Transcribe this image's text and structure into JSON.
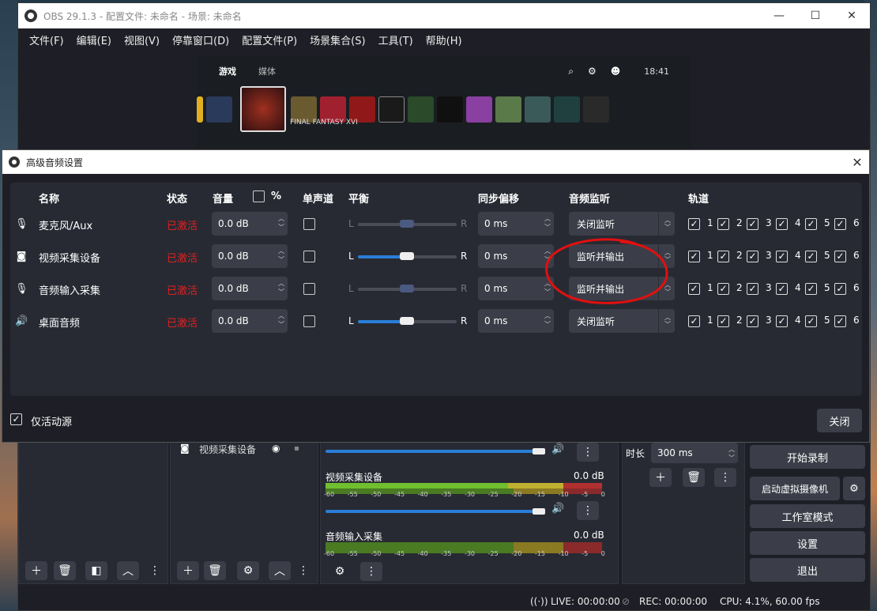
{
  "window": {
    "title": "OBS 29.1.3 - 配置文件: 未命名 - 场景: 未命名",
    "minimize": "—",
    "maximize": "☐",
    "close": "✕"
  },
  "menu": [
    "文件(F)",
    "编辑(E)",
    "视图(V)",
    "停靠窗口(D)",
    "配置文件(P)",
    "场景集合(S)",
    "工具(T)",
    "帮助(H)"
  ],
  "preview": {
    "tab_games": "游戏",
    "tab_media": "媒体",
    "time": "18:41",
    "caption": "FINAL FANTASY XVI"
  },
  "dialog": {
    "title": "高级音频设置",
    "close_x": "✕",
    "headers": {
      "name": "名称",
      "status": "状态",
      "volume": "音量",
      "percent": "%",
      "mono": "单声道",
      "balance": "平衡",
      "sync_offset": "同步偏移",
      "monitoring": "音频监听",
      "tracks": "轨道"
    },
    "pan_left": "L",
    "pan_right": "R",
    "rows": [
      {
        "icon": "microphone-icon",
        "name": "麦克风/Aux",
        "status": "已激活",
        "volume": "0.0 dB",
        "offset": "0 ms",
        "monitor": "关闭监听",
        "tracks": [
          "1",
          "2",
          "3",
          "4",
          "5",
          "6"
        ],
        "pan_active": false
      },
      {
        "icon": "camera-icon",
        "name": "视频采集设备",
        "status": "已激活",
        "volume": "0.0 dB",
        "offset": "0 ms",
        "monitor": "监听并输出",
        "tracks": [
          "1",
          "2",
          "3",
          "4",
          "5",
          "6"
        ],
        "pan_active": true
      },
      {
        "icon": "microphone-icon",
        "name": "音频输入采集",
        "status": "已激活",
        "volume": "0.0 dB",
        "offset": "0 ms",
        "monitor": "监听并输出",
        "tracks": [
          "1",
          "2",
          "3",
          "4",
          "5",
          "6"
        ],
        "pan_active": false
      },
      {
        "icon": "speaker-icon",
        "name": "桌面音频",
        "status": "已激活",
        "volume": "0.0 dB",
        "offset": "0 ms",
        "monitor": "关闭监听",
        "tracks": [
          "1",
          "2",
          "3",
          "4",
          "5",
          "6"
        ],
        "pan_active": true
      }
    ],
    "active_only_label": "仅活动源",
    "close_button": "关闭"
  },
  "docks": {
    "source_item": "视频采集设备",
    "mixer": [
      {
        "name": "视频采集设备",
        "db": "0.0 dB"
      },
      {
        "name": "音频输入采集",
        "db": "0.0 dB"
      }
    ],
    "scale": [
      "-60",
      "-55",
      "-50",
      "-45",
      "-40",
      "-35",
      "-30",
      "-25",
      "-20",
      "-15",
      "-10",
      "-5",
      "0"
    ],
    "transition_label": "时长",
    "transition_value": "300 ms",
    "controls": [
      "开始录制",
      "启动虚拟摄像机",
      "工作室模式",
      "设置",
      "退出"
    ]
  },
  "status": {
    "live": "LIVE: 00:00:00",
    "rec": "REC: 00:00:00",
    "cpu": "CPU: 4.1%, 60.00 fps"
  },
  "colors": {
    "accent": "#2a7ed8",
    "status_red": "#e02020",
    "annotation_red": "#e01010"
  }
}
